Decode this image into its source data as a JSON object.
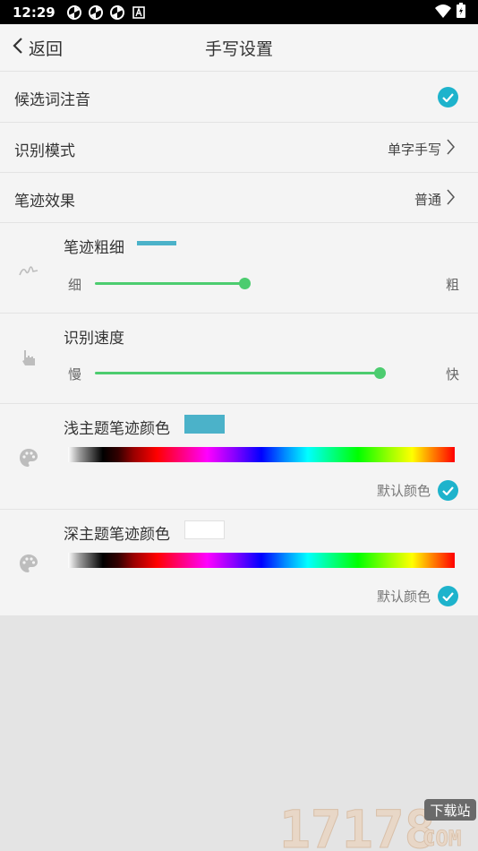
{
  "status_bar": {
    "time": "12:29",
    "notification_icons": [
      "pinwheel-icon",
      "pinwheel-icon",
      "pinwheel-icon",
      "a-icon"
    ],
    "right_icons": [
      "wifi-icon",
      "battery-icon"
    ]
  },
  "app_bar": {
    "back_label": "返回",
    "title": "手写设置"
  },
  "settings": {
    "candidate_pinyin": {
      "label": "候选词注音",
      "checked": true
    },
    "recognition_mode": {
      "label": "识别模式",
      "value": "单字手写"
    },
    "stroke_effect": {
      "label": "笔迹效果",
      "value": "普通"
    },
    "stroke_width": {
      "label": "笔迹粗细",
      "min_label": "细",
      "max_label": "粗",
      "level": 0.4,
      "swatch_color": "#4bb2c9"
    },
    "recognition_speed": {
      "label": "识别速度",
      "min_label": "慢",
      "max_label": "快",
      "level": 0.95
    },
    "light_theme_color": {
      "label": "浅主题笔迹颜色",
      "swatch_color": "#4bb2c9",
      "default_label": "默认颜色",
      "default_checked": true
    },
    "dark_theme_color": {
      "label": "深主题笔迹颜色",
      "swatch_color": "#ffffff",
      "default_label": "默认颜色",
      "default_checked": true
    }
  },
  "colors": {
    "accent": "#1eb3cc",
    "slider": "#4ccc6f"
  },
  "watermark": {
    "text": "17178",
    "badge": "下载站",
    "suffix": "COM"
  }
}
